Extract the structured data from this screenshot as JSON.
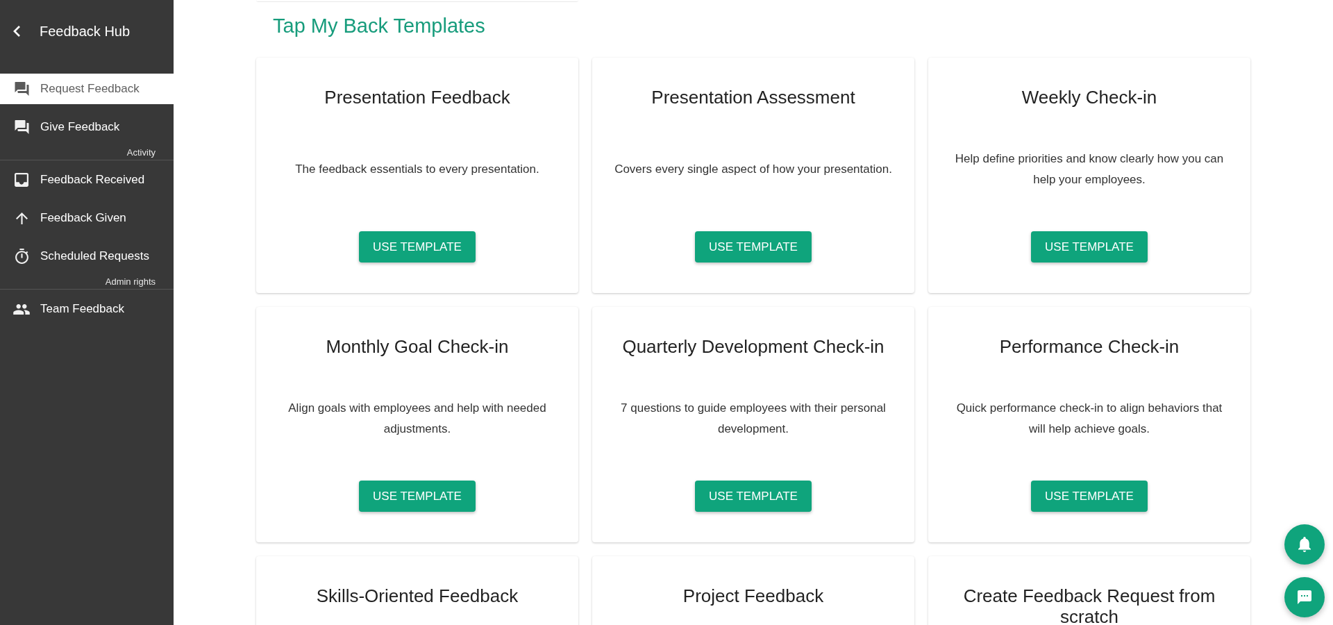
{
  "sidebar": {
    "title": "Feedback Hub",
    "sections": [
      {
        "items": [
          {
            "label": "Request Feedback",
            "selected": true
          },
          {
            "label": "Give Feedback",
            "selected": false
          }
        ]
      },
      {
        "heading": "Activity",
        "items": [
          {
            "label": "Feedback Received",
            "selected": false
          },
          {
            "label": "Feedback Given",
            "selected": false
          },
          {
            "label": "Scheduled Requests",
            "selected": false
          }
        ]
      },
      {
        "heading": "Admin rights",
        "items": [
          {
            "label": "Team Feedback",
            "selected": false
          }
        ]
      }
    ]
  },
  "main": {
    "title": "Tap My Back Templates",
    "templates": [
      {
        "title": "Presentation Feedback",
        "description": "The feedback essentials to every presentation.",
        "button": "USE TEMPLATE"
      },
      {
        "title": "Presentation Assessment",
        "description": "Covers every single aspect of how your presentation.",
        "button": "USE TEMPLATE"
      },
      {
        "title": "Weekly Check-in",
        "description": "Help define priorities and know clearly how you can help your employees.",
        "button": "USE TEMPLATE"
      },
      {
        "title": "Monthly Goal Check-in",
        "description": "Align goals with employees and help with needed adjustments.",
        "button": "USE TEMPLATE"
      },
      {
        "title": "Quarterly Development Check-in",
        "description": "7 questions to guide employees with their personal development.",
        "button": "USE TEMPLATE"
      },
      {
        "title": "Performance Check-in",
        "description": "Quick performance check-in to align behaviors that will help achieve goals.",
        "button": "USE TEMPLATE"
      },
      {
        "title": "Skills-Oriented Feedback"
      },
      {
        "title": "Project Feedback"
      },
      {
        "title": "Create Feedback Request from scratch"
      }
    ]
  }
}
